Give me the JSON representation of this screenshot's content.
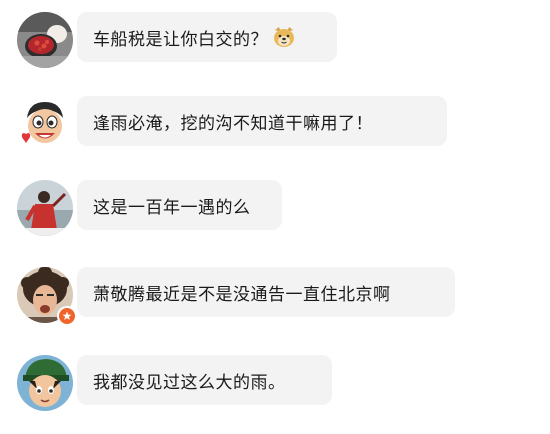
{
  "comments": [
    {
      "text": "车船税是让你白交的？",
      "emoji": "doge-emoji",
      "avatar_icon": "food-photo-avatar"
    },
    {
      "text": "逢雨必淹，挖的沟不知道干嘛用了！",
      "avatar_icon": "cartoon-boy-avatar"
    },
    {
      "text": "这是一百年一遇的么",
      "avatar_icon": "photo-person-red-avatar"
    },
    {
      "text": "萧敬腾最近是不是没通告一直住北京啊",
      "avatar_icon": "photo-curly-hair-avatar",
      "badge_icon": "verified-badge-icon"
    },
    {
      "text": "我都没见过这么大的雨。",
      "avatar_icon": "anime-boy-avatar"
    }
  ],
  "colors": {
    "bubble": "#f3f3f3",
    "text": "#1a1a1a",
    "badge": "#f0642c"
  }
}
